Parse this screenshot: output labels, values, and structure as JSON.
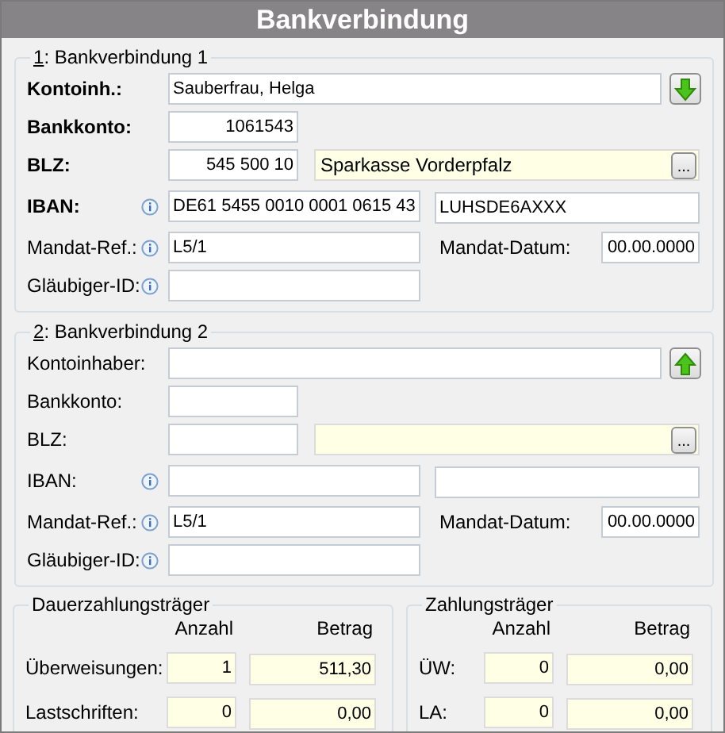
{
  "title": "Bankverbindung",
  "sections": [
    {
      "accel": "1",
      "legend": ": Bankverbindung 1",
      "holder": {
        "label": "Kontoinh.:",
        "bold": true,
        "value": "Sauberfrau, Helga",
        "arrow_up": false
      },
      "account": {
        "label": "Bankkonto:",
        "bold": true,
        "value": "1061543"
      },
      "blz": {
        "label": "BLZ:",
        "bold": true,
        "value": "545 500 10",
        "bank_name": "Sparkasse Vorderpfalz",
        "button": "..."
      },
      "iban": {
        "label": "IBAN:",
        "bold": true,
        "value": "DE61 5455 0010 0001 0615 43",
        "bic": "LUHSDE6AXXX"
      },
      "mandate": {
        "label": "Mandat-Ref.:",
        "value": "L5/1",
        "date_label": "Mandat-Datum:",
        "date": "00.00.0000"
      },
      "creditor": {
        "label": "Gläubiger-ID:"
      }
    },
    {
      "accel": "2",
      "legend": ": Bankverbindung 2",
      "holder": {
        "label": "Kontoinhaber:",
        "bold": false,
        "arrow_up": true
      },
      "account": {
        "label": "Bankkonto:",
        "bold": false
      },
      "blz": {
        "label": "BLZ:",
        "bold": false,
        "button": "..."
      },
      "iban": {
        "label": "IBAN:",
        "bold": false
      },
      "mandate": {
        "label": "Mandat-Ref.:",
        "value": "L5/1",
        "date_label": "Mandat-Datum:",
        "date": "00.00.0000"
      },
      "creditor": {
        "label": "Gläubiger-ID:"
      }
    }
  ],
  "totals": [
    {
      "title": "Dauerzahlungsträger",
      "columns": [
        "Anzahl",
        "Betrag"
      ],
      "rows": [
        {
          "label": "Überweisungen:",
          "count": "1",
          "amount": "511,30"
        },
        {
          "label": "Lastschriften:",
          "count": "0",
          "amount": "0,00"
        }
      ]
    },
    {
      "title": "Zahlungsträger",
      "columns": [
        "Anzahl",
        "Betrag"
      ],
      "rows": [
        {
          "label": "ÜW:",
          "count": "0",
          "amount": "0,00"
        },
        {
          "label": "LA:",
          "count": "0",
          "amount": "0,00"
        }
      ]
    }
  ]
}
